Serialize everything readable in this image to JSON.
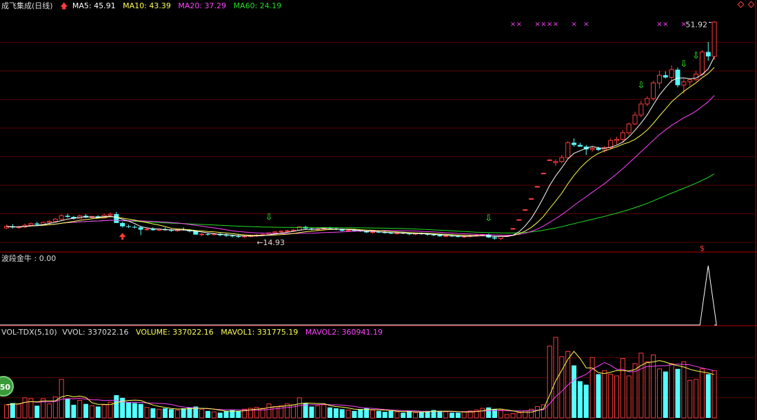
{
  "header": {
    "stock": "成飞集成(日线)",
    "ma5": "MA5: 45.91",
    "ma10": "MA10: 43.39",
    "ma20": "MA20: 37.29",
    "ma60": "MA60: 24.19"
  },
  "indicator": {
    "label": "波段金牛 : 0.00"
  },
  "volume_panel": {
    "name": "VOL-TDX(5,10)",
    "vvol": "VVOL: 337022.16",
    "volume": "VOLUME: 337022.16",
    "mavol1": "MAVOL1: 331775.19",
    "mavol2": "MAVOL2: 360941.19"
  },
  "badge": "50",
  "colors": {
    "up": "#ff3c3c",
    "down": "#54ffff",
    "ma5": "#ffffff",
    "ma10": "#ffff55",
    "ma20": "#ff44ff",
    "ma60": "#22dd22",
    "grid": "#5a0000",
    "frame": "#b40000"
  },
  "chart_data": {
    "type": "candlestick",
    "price_labels": {
      "high": "51.92",
      "low": "14.93"
    },
    "price_range": [
      13.2,
      54.5
    ],
    "volume_range": [
      0,
      920000
    ],
    "candles": [
      [
        15.8,
        16.4,
        15.6,
        16.1,
        150000
      ],
      [
        16.1,
        16.5,
        15.7,
        15.9,
        170000
      ],
      [
        15.9,
        16.2,
        15.6,
        16.0,
        160000
      ],
      [
        16.0,
        16.6,
        15.8,
        16.3,
        230000
      ],
      [
        16.3,
        16.8,
        16.0,
        16.6,
        220000
      ],
      [
        16.6,
        16.9,
        16.2,
        16.4,
        140000
      ],
      [
        16.4,
        17.0,
        16.2,
        16.8,
        220000
      ],
      [
        16.8,
        17.2,
        16.5,
        17.0,
        160000
      ],
      [
        17.0,
        17.6,
        16.8,
        17.4,
        240000
      ],
      [
        17.4,
        18.3,
        17.2,
        18.0,
        440000
      ],
      [
        18.0,
        18.4,
        17.6,
        17.8,
        220000
      ],
      [
        17.8,
        18.0,
        17.3,
        17.5,
        150000
      ],
      [
        17.5,
        18.2,
        17.4,
        18.0,
        200000
      ],
      [
        18.0,
        18.3,
        17.6,
        17.7,
        160000
      ],
      [
        17.7,
        18.0,
        17.4,
        17.9,
        140000
      ],
      [
        17.9,
        18.1,
        17.5,
        17.6,
        130000
      ],
      [
        17.6,
        18.4,
        17.5,
        18.1,
        150000
      ],
      [
        18.1,
        18.6,
        17.9,
        18.3,
        180000
      ],
      [
        18.3,
        18.7,
        17.6,
        16.7,
        260000
      ],
      [
        16.7,
        16.9,
        15.9,
        16.1,
        230000
      ],
      [
        16.1,
        16.4,
        15.8,
        16.0,
        180000
      ],
      [
        16.0,
        16.3,
        15.7,
        15.9,
        170000
      ],
      [
        15.9,
        16.2,
        14.5,
        15.5,
        160000
      ],
      [
        15.5,
        15.8,
        15.3,
        15.6,
        120000
      ],
      [
        15.6,
        15.9,
        15.3,
        15.4,
        110000
      ],
      [
        15.4,
        15.7,
        15.2,
        15.6,
        100000
      ],
      [
        15.6,
        15.9,
        15.3,
        15.4,
        110000
      ],
      [
        15.4,
        15.6,
        15.1,
        15.3,
        100000
      ],
      [
        15.3,
        15.6,
        15.1,
        15.5,
        90000
      ],
      [
        15.5,
        15.9,
        15.3,
        15.4,
        110000
      ],
      [
        15.4,
        15.6,
        15.0,
        15.2,
        120000
      ],
      [
        15.2,
        15.4,
        14.8,
        14.6,
        130000
      ],
      [
        14.6,
        14.9,
        14.3,
        14.7,
        100000
      ],
      [
        14.7,
        14.9,
        14.4,
        14.6,
        80000
      ],
      [
        14.6,
        14.9,
        14.4,
        14.75,
        70000
      ],
      [
        14.75,
        14.9,
        14.3,
        14.5,
        60000
      ],
      [
        14.5,
        14.8,
        14.2,
        14.4,
        80000
      ],
      [
        14.4,
        14.6,
        14.1,
        14.3,
        90000
      ],
      [
        14.3,
        14.6,
        14.0,
        14.2,
        80000
      ],
      [
        14.2,
        14.5,
        14.0,
        14.35,
        100000
      ],
      [
        14.35,
        14.6,
        14.1,
        14.4,
        110000
      ],
      [
        14.4,
        14.7,
        14.2,
        14.5,
        120000
      ],
      [
        14.5,
        14.8,
        14.3,
        14.6,
        110000
      ],
      [
        14.6,
        15.0,
        14.4,
        14.9,
        160000
      ],
      [
        14.9,
        15.2,
        14.7,
        15.1,
        130000
      ],
      [
        15.1,
        15.4,
        14.9,
        15.2,
        140000
      ],
      [
        15.2,
        15.5,
        15.0,
        15.3,
        160000
      ],
      [
        15.3,
        15.6,
        15.1,
        15.4,
        150000
      ],
      [
        15.4,
        16.1,
        15.3,
        16.0,
        230000
      ],
      [
        16.0,
        16.2,
        15.6,
        15.7,
        170000
      ],
      [
        15.7,
        15.9,
        15.4,
        15.5,
        130000
      ],
      [
        15.5,
        15.8,
        15.3,
        15.6,
        140000
      ],
      [
        15.6,
        15.9,
        15.4,
        15.75,
        150000
      ],
      [
        15.75,
        16.0,
        15.5,
        15.7,
        120000
      ],
      [
        15.7,
        15.9,
        15.4,
        15.5,
        110000
      ],
      [
        15.5,
        15.7,
        15.2,
        15.3,
        100000
      ],
      [
        15.3,
        15.6,
        15.1,
        15.4,
        90000
      ],
      [
        15.4,
        15.6,
        15.2,
        15.3,
        80000
      ],
      [
        15.3,
        15.5,
        15.1,
        15.2,
        100000
      ],
      [
        15.2,
        15.4,
        14.9,
        15.0,
        110000
      ],
      [
        15.0,
        15.3,
        14.8,
        15.1,
        90000
      ],
      [
        15.1,
        15.3,
        14.9,
        15.0,
        80000
      ],
      [
        15.0,
        15.2,
        14.8,
        14.9,
        70000
      ],
      [
        14.9,
        15.1,
        14.7,
        14.8,
        80000
      ],
      [
        14.8,
        15.0,
        14.6,
        14.9,
        70000
      ],
      [
        14.9,
        15.1,
        14.7,
        14.8,
        60000
      ],
      [
        14.8,
        15.0,
        14.5,
        14.7,
        80000
      ],
      [
        14.7,
        14.9,
        14.5,
        14.8,
        60000
      ],
      [
        14.8,
        15.0,
        14.6,
        14.7,
        70000
      ],
      [
        14.7,
        14.9,
        14.4,
        14.6,
        80000
      ],
      [
        14.6,
        14.8,
        14.3,
        14.5,
        90000
      ],
      [
        14.5,
        14.7,
        14.2,
        14.3,
        80000
      ],
      [
        14.3,
        14.6,
        14.1,
        14.4,
        70000
      ],
      [
        14.4,
        14.6,
        14.2,
        14.3,
        60000
      ],
      [
        14.3,
        14.5,
        14.1,
        14.2,
        60000
      ],
      [
        14.2,
        14.45,
        14.0,
        14.3,
        70000
      ],
      [
        14.3,
        14.6,
        14.1,
        14.4,
        80000
      ],
      [
        14.4,
        14.7,
        14.2,
        14.5,
        90000
      ],
      [
        14.5,
        14.7,
        14.3,
        14.6,
        110000
      ],
      [
        14.6,
        14.8,
        14.0,
        14.1,
        120000
      ],
      [
        14.1,
        14.4,
        13.7,
        13.9,
        100000
      ],
      [
        13.9,
        14.4,
        13.6,
        14.3,
        90000
      ],
      [
        14.3,
        14.5,
        14.2,
        14.4,
        40000
      ],
      [
        15.6,
        15.8,
        15.5,
        15.7,
        50000
      ],
      [
        17.2,
        17.4,
        17.1,
        17.3,
        60000
      ],
      [
        19.0,
        19.2,
        18.9,
        19.1,
        80000
      ],
      [
        21.0,
        21.2,
        20.9,
        21.1,
        100000
      ],
      [
        23.2,
        23.4,
        23.1,
        23.3,
        130000
      ],
      [
        25.6,
        25.8,
        25.5,
        25.7,
        150000
      ],
      [
        28.0,
        28.2,
        27.9,
        28.1,
        820000
      ],
      [
        27.6,
        28.2,
        27.0,
        27.8,
        920000
      ],
      [
        27.8,
        29.0,
        27.5,
        28.5,
        700000
      ],
      [
        28.5,
        31.5,
        28.3,
        31.2,
        760000
      ],
      [
        31.2,
        32.0,
        30.5,
        30.8,
        600000
      ],
      [
        30.8,
        31.2,
        30.5,
        30.5,
        420000
      ],
      [
        30.5,
        30.8,
        29.0,
        30.0,
        380000
      ],
      [
        30.0,
        30.6,
        29.6,
        30.2,
        690000
      ],
      [
        30.2,
        30.5,
        29.7,
        29.9,
        500000
      ],
      [
        29.9,
        30.6,
        29.4,
        30.3,
        540000
      ],
      [
        30.3,
        32.0,
        30.0,
        31.6,
        500000
      ],
      [
        31.6,
        32.3,
        30.9,
        31.8,
        480000
      ],
      [
        31.8,
        33.5,
        31.2,
        33.0,
        680000
      ],
      [
        33.0,
        34.8,
        32.5,
        34.6,
        480000
      ],
      [
        34.6,
        36.8,
        34.4,
        36.2,
        620000
      ],
      [
        36.2,
        38.8,
        35.8,
        38.2,
        740000
      ],
      [
        38.2,
        39.6,
        37.8,
        39.2,
        640000
      ],
      [
        39.2,
        42.4,
        38.8,
        42.0,
        720000
      ],
      [
        42.0,
        44.2,
        41.0,
        43.4,
        560000
      ],
      [
        43.4,
        44.1,
        42.8,
        43.0,
        530000
      ],
      [
        43.0,
        45.2,
        42.0,
        44.4,
        620000
      ],
      [
        44.4,
        44.8,
        41.2,
        41.6,
        560000
      ],
      [
        41.6,
        42.7,
        40.1,
        42.2,
        640000
      ],
      [
        42.2,
        42.7,
        41.5,
        42.6,
        430000
      ],
      [
        42.6,
        44.2,
        42.3,
        43.6,
        440000
      ],
      [
        43.6,
        47.9,
        43.3,
        47.6,
        560000
      ],
      [
        47.6,
        49.4,
        46.0,
        46.8,
        500000
      ],
      [
        46.8,
        53.2,
        46.2,
        53.0,
        540000
      ]
    ],
    "ma_lines": {
      "ma5": "#ffffff",
      "ma10": "#ffff55",
      "ma20": "#ff44ff",
      "ma60": "#22dd22"
    },
    "ma_endpoints": {
      "ma5": 45.91,
      "ma10": 43.39,
      "ma20": 37.29,
      "ma60": 24.19
    },
    "buy_arrows_down": [
      43,
      79,
      104,
      111,
      113
    ],
    "sell_arrow_up": [
      19
    ],
    "x_marks": [
      83,
      84,
      87,
      88,
      89,
      90,
      93,
      95,
      107,
      108,
      111
    ],
    "s_marker": 114,
    "indicator_series": {
      "spike_index": 115,
      "spike_value": 1.0
    }
  }
}
